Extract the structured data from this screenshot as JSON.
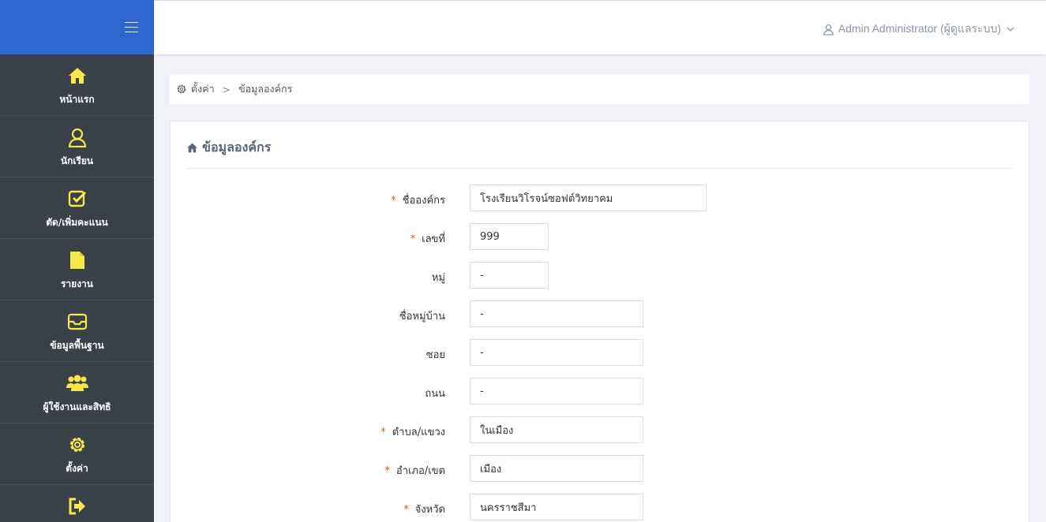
{
  "colors": {
    "brand": "#2f66d1",
    "sidebar": "#3a4149",
    "icon_yellow": "#f6e84a",
    "required": "#e0561e"
  },
  "topbar": {
    "user_label": "Admin Administrator (ผู้ดูแลระบบ)"
  },
  "sidebar": {
    "items": [
      {
        "label": "หน้าแรก",
        "icon": "home-icon"
      },
      {
        "label": "นักเรียน",
        "icon": "student-icon"
      },
      {
        "label": "ตัด/เพิ่มคะแนน",
        "icon": "check-square-icon"
      },
      {
        "label": "รายงาน",
        "icon": "file-icon"
      },
      {
        "label": "ข้อมูลพื้นฐาน",
        "icon": "inbox-icon"
      },
      {
        "label": "ผู้ใช้งานและสิทธิ",
        "icon": "users-icon"
      },
      {
        "label": "ตั้งค่า",
        "icon": "gear-icon"
      },
      {
        "label": "",
        "icon": "sign-out-icon"
      }
    ]
  },
  "breadcrumb": {
    "root": "ตั้งค่า",
    "current": "ข้อมูลองค์กร"
  },
  "panel": {
    "title": "ข้อมูลองค์กร"
  },
  "form": {
    "fields": [
      {
        "label": "ชื่อองค์กร",
        "required": "*",
        "value": "โรงเรียนวิโรจน์ซอฟต์วิทยาคม"
      },
      {
        "label": "เลขที่",
        "required": "*",
        "value": "999"
      },
      {
        "label": "หมู่",
        "required": "",
        "value": "-"
      },
      {
        "label": "ชื่อหมู่บ้าน",
        "required": "",
        "value": "-"
      },
      {
        "label": "ซอย",
        "required": "",
        "value": "-"
      },
      {
        "label": "ถนน",
        "required": "",
        "value": "-"
      },
      {
        "label": "ตำบล/แขวง",
        "required": "*",
        "value": "ในเมือง"
      },
      {
        "label": "อำเภอ/เขต",
        "required": "*",
        "value": "เมือง"
      },
      {
        "label": "จังหวัด",
        "required": "*",
        "value": "นครราชสีมา"
      }
    ]
  }
}
